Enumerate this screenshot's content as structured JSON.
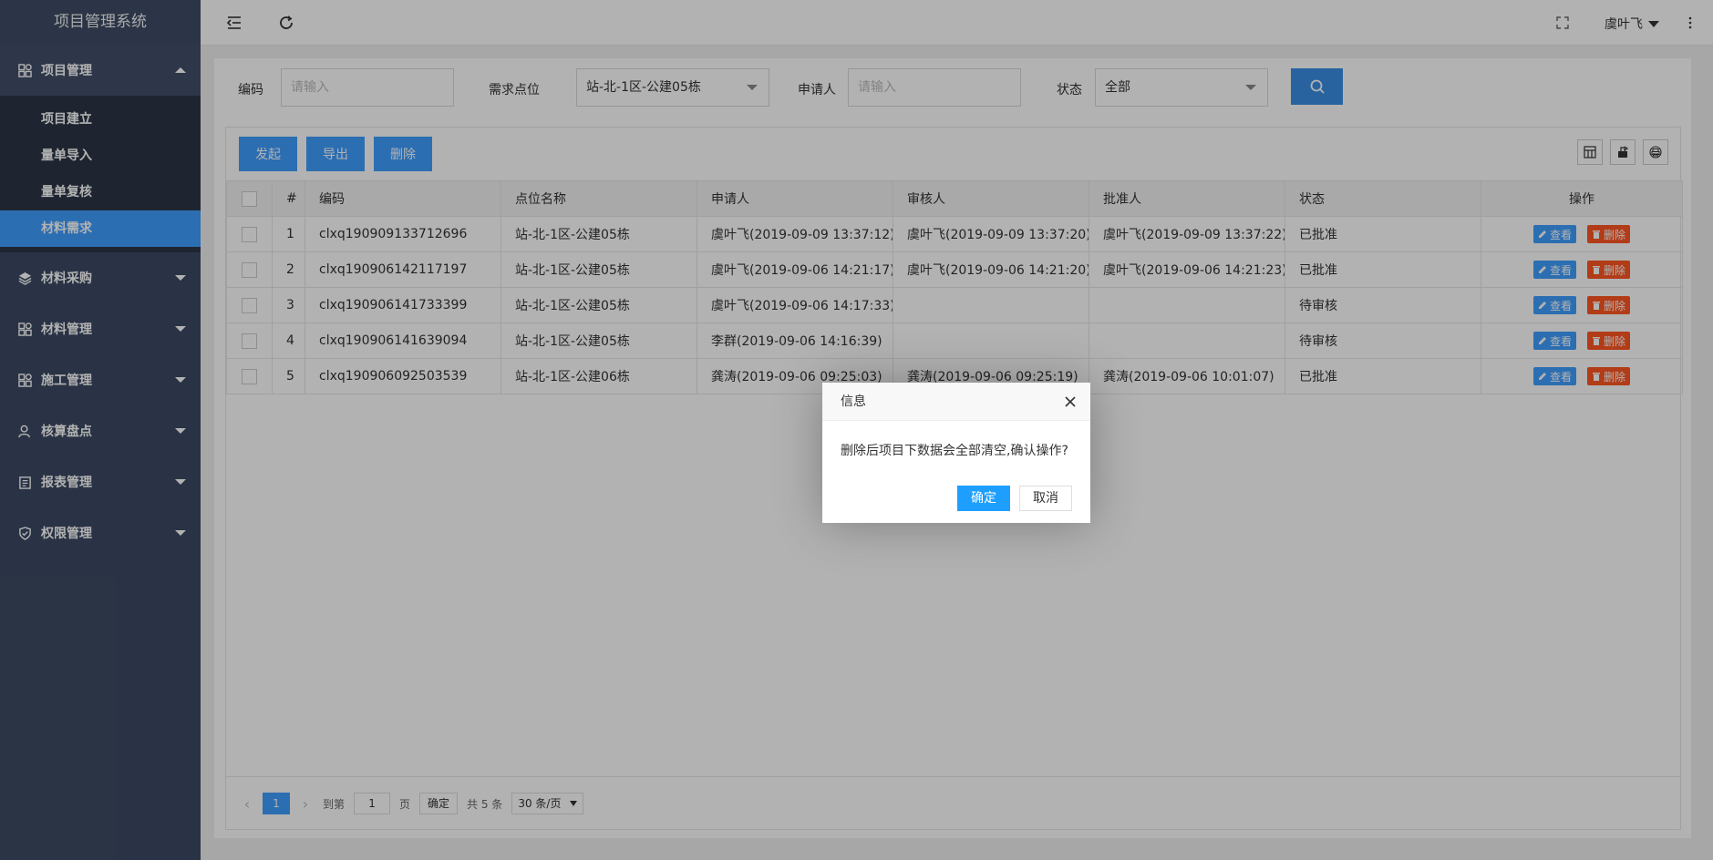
{
  "sidebar": {
    "brand": "项目管理系统",
    "groups": [
      {
        "label": "项目管理",
        "icon": "grid-icon",
        "open": true
      },
      {
        "label": "材料采购",
        "icon": "layers-icon"
      },
      {
        "label": "材料管理",
        "icon": "grid-icon"
      },
      {
        "label": "施工管理",
        "icon": "grid-icon"
      },
      {
        "label": "核算盘点",
        "icon": "user-icon"
      },
      {
        "label": "报表管理",
        "icon": "clipboard-icon"
      },
      {
        "label": "权限管理",
        "icon": "shield-icon"
      }
    ],
    "subitems": [
      "项目建立",
      "量单导入",
      "量单复核",
      "材料需求"
    ],
    "active_subitem": "材料需求"
  },
  "header": {
    "user": "虞叶飞"
  },
  "filters": {
    "code_label": "编码",
    "code_placeholder": "请输入",
    "site_label": "需求点位",
    "site_value": "站-北-1区-公建05栋",
    "applicant_label": "申请人",
    "applicant_placeholder": "请输入",
    "status_label": "状态",
    "status_value": "全部"
  },
  "toolbar": {
    "launch": "发起",
    "export": "导出",
    "delete": "删除"
  },
  "table": {
    "headers": [
      "#",
      "编码",
      "点位名称",
      "申请人",
      "审核人",
      "批准人",
      "状态",
      "操作"
    ],
    "rows": [
      {
        "no": "1",
        "code": "clxq190909133712696",
        "site": "站-北-1区-公建05栋",
        "applicant": "虞叶飞(2019-09-09 13:37:12)",
        "reviewer": "虞叶飞(2019-09-09 13:37:20)",
        "approver": "虞叶飞(2019-09-09 13:37:22)",
        "status": "已批准",
        "status_type": "ok"
      },
      {
        "no": "2",
        "code": "clxq190906142117197",
        "site": "站-北-1区-公建05栋",
        "applicant": "虞叶飞(2019-09-06 14:21:17)",
        "reviewer": "虞叶飞(2019-09-06 14:21:20)",
        "approver": "虞叶飞(2019-09-06 14:21:23)",
        "status": "已批准",
        "status_type": "ok"
      },
      {
        "no": "3",
        "code": "clxq190906141733399",
        "site": "站-北-1区-公建05栋",
        "applicant": "虞叶飞(2019-09-06 14:17:33)",
        "reviewer": "",
        "approver": "",
        "status": "待审核",
        "status_type": "wait"
      },
      {
        "no": "4",
        "code": "clxq190906141639094",
        "site": "站-北-1区-公建05栋",
        "applicant": "李群(2019-09-06 14:16:39)",
        "reviewer": "",
        "approver": "",
        "status": "待审核",
        "status_type": "wait"
      },
      {
        "no": "5",
        "code": "clxq190906092503539",
        "site": "站-北-1区-公建06栋",
        "applicant": "龚涛(2019-09-06 09:25:03)",
        "reviewer": "龚涛(2019-09-06 09:25:19)",
        "approver": "龚涛(2019-09-06 10:01:07)",
        "status": "已批准",
        "status_type": "ok"
      }
    ],
    "view_label": "查看",
    "delete_label": "删除"
  },
  "pager": {
    "current": "1",
    "goto_label": "到第",
    "goto_value": "1",
    "page_unit": "页",
    "confirm": "确定",
    "total": "共 5 条",
    "page_size": "30 条/页"
  },
  "dialog": {
    "title": "信息",
    "message": "删除后项目下数据会全部清空,确认操作?",
    "ok": "确定",
    "cancel": "取消"
  },
  "colors": {
    "sidebar_bg": "#3c4a63",
    "active": "#409eff",
    "approved": "#2aa515",
    "pending": "#3a8ee6",
    "danger": "#ff5722"
  }
}
